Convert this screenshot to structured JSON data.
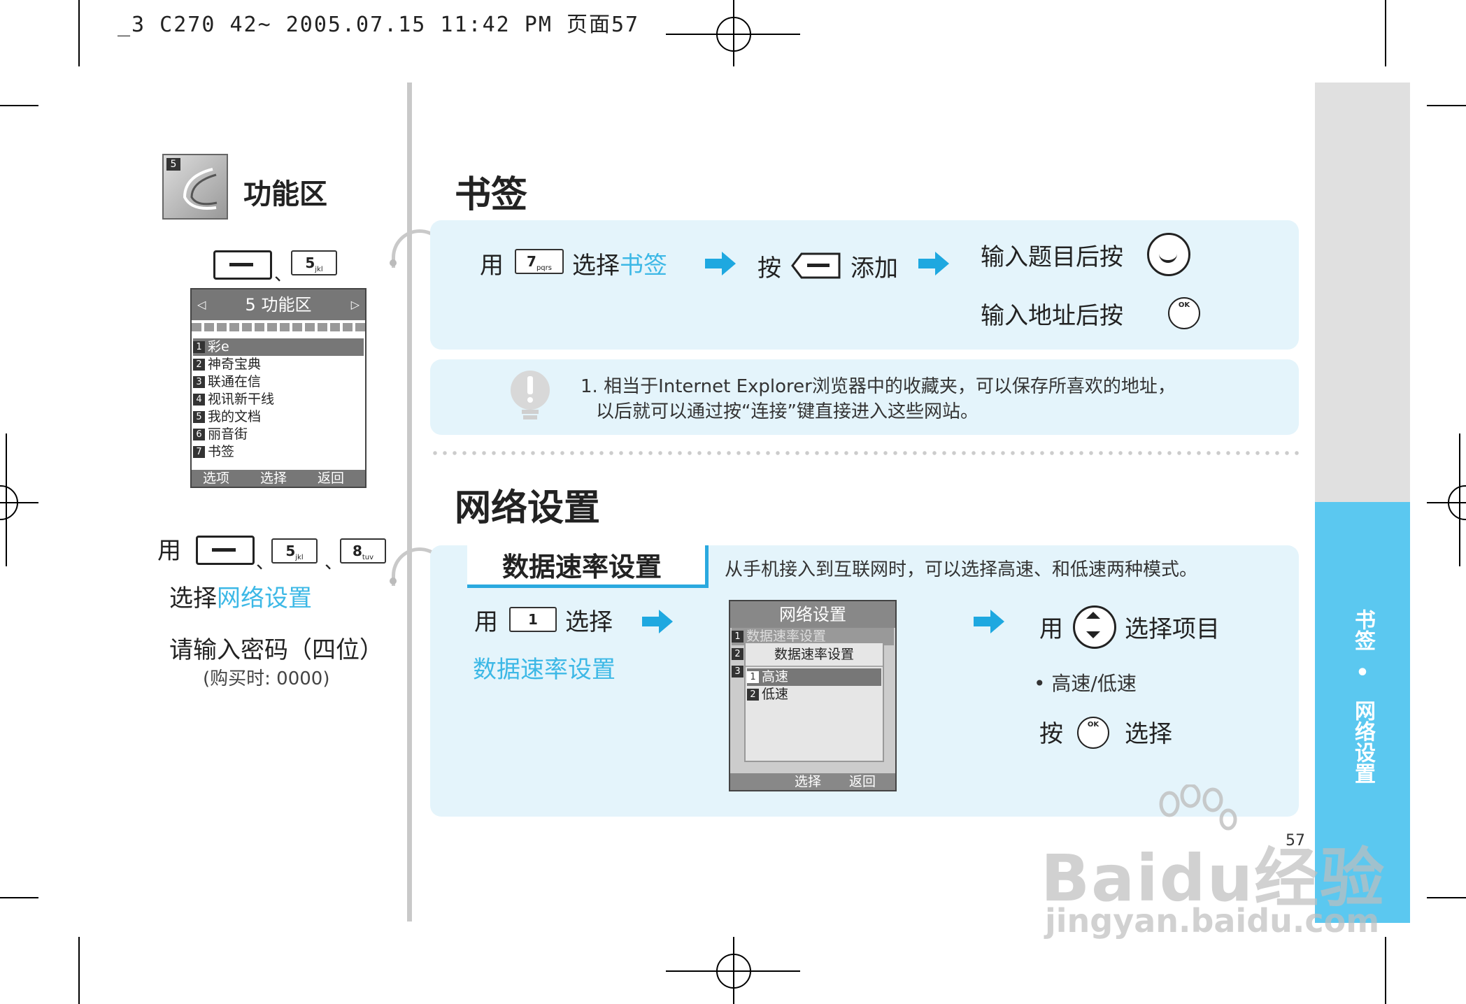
{
  "header": {
    "text": "_3 C270 42~ 2005.07.15 11:42 PM 页面57"
  },
  "sidebar": {
    "tab_top": "书签",
    "dot": "•",
    "tab_bottom": "网络设置"
  },
  "page_number": "57",
  "left": {
    "chapter_num": "5",
    "chapter_title": "功能区",
    "sep1": "、",
    "key5_1": "5",
    "key5_1_sub": "jkl",
    "phone1": {
      "title": "5 功能区",
      "items": [
        {
          "n": "1",
          "label": "彩e"
        },
        {
          "n": "2",
          "label": "神奇宝典"
        },
        {
          "n": "3",
          "label": "联通在信"
        },
        {
          "n": "4",
          "label": "视讯新干线"
        },
        {
          "n": "5",
          "label": "我的文档"
        },
        {
          "n": "6",
          "label": "丽音街"
        },
        {
          "n": "7",
          "label": "书签"
        }
      ],
      "soft_left": "选项",
      "soft_mid": "选择",
      "soft_right": "返回"
    },
    "use": "用",
    "sep2": "、",
    "sep3": "、",
    "key5_2": "5",
    "key5_2_sub": "jkl",
    "key8": "8",
    "key8_sub": "tuv",
    "select_prefix": "选择",
    "select_target": "网络设置",
    "password_prompt": "请输入密码（四位）",
    "password_hint": "(购买时: 0000)"
  },
  "bookmark": {
    "heading": "书签",
    "use": "用",
    "key7": "7",
    "key7_sub": "pqrs",
    "select": "选择",
    "select_target": "书签",
    "press": "按",
    "add": "添加",
    "title_prompt": "输入题目后按",
    "addr_prompt": "输入地址后按",
    "ok_label": "OK",
    "note_line1": "1. 相当于Internet Explorer浏览器中的收藏夹，可以保存所喜欢的地址，",
    "note_line2": "以后就可以通过按“连接”键直接进入这些网站。"
  },
  "network": {
    "heading": "网络设置",
    "sub_heading": "数据速率设置",
    "description": "从手机接入到互联网时，可以选择高速、和低速两种模式。",
    "use": "用",
    "key1": "1",
    "select": "选择",
    "select_target": "数据速率设置",
    "phone2": {
      "title": "网络设置",
      "bg_items": [
        {
          "n": "1",
          "label": "数据速率设置"
        },
        {
          "n": "2",
          "label": ""
        },
        {
          "n": "3",
          "label": ""
        }
      ],
      "popup_title": "数据速率设置",
      "popup_items": [
        {
          "n": "1",
          "label": "高速"
        },
        {
          "n": "2",
          "label": "低速"
        }
      ],
      "soft_mid": "选择",
      "soft_right": "返回"
    },
    "use_nav": "用",
    "select_item": "选择项目",
    "bullet": "• 高速/低速",
    "press": "按",
    "ok_label": "OK",
    "select2": "选择"
  },
  "watermark": {
    "logo": "Baidu经验",
    "url": "jingyan.baidu.com"
  },
  "colors": {
    "accent": "#3cb8e6",
    "panel": "#e4f4fb",
    "sidebar": "#5bc8f0",
    "arrow": "#1ea8e0"
  }
}
